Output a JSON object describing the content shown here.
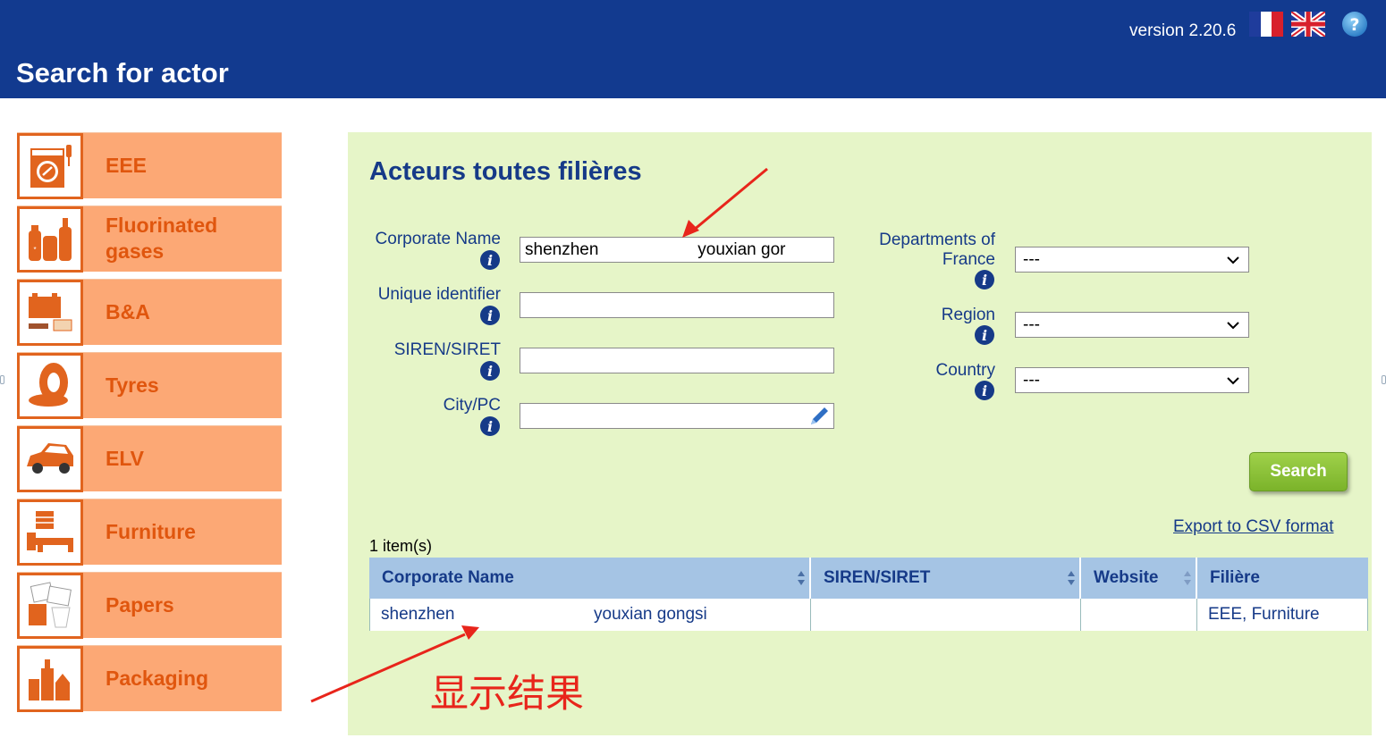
{
  "header": {
    "title": "Search for actor",
    "version": "version 2.20.6",
    "flags": [
      "flag-fr-icon",
      "flag-uk-icon"
    ],
    "help_icon": "help-icon",
    "bg_color": "#123a8f"
  },
  "sidebar": {
    "items": [
      {
        "label": "EEE",
        "icon": "washing-machine-icon"
      },
      {
        "label": "Fluorinated gases",
        "icon": "gas-cylinder-icon"
      },
      {
        "label": "B&A",
        "icon": "battery-icon"
      },
      {
        "label": "Tyres",
        "icon": "tyre-icon"
      },
      {
        "label": "ELV",
        "icon": "car-icon"
      },
      {
        "label": "Furniture",
        "icon": "furniture-icon"
      },
      {
        "label": "Papers",
        "icon": "papers-icon"
      },
      {
        "label": "Packaging",
        "icon": "packaging-icon"
      }
    ],
    "item_color": "#fca875",
    "label_color": "#e0560e"
  },
  "panel": {
    "title": "Acteurs toutes filières",
    "bg_color": "#e6f5c8",
    "fields": {
      "corporate_name": {
        "label": "Corporate Name",
        "value": "shenzhen                     youxian gor"
      },
      "unique_identifier": {
        "label": "Unique identifier",
        "value": ""
      },
      "siren_siret": {
        "label": "SIREN/SIRET",
        "value": ""
      },
      "city_pc": {
        "label": "City/PC",
        "value": ""
      },
      "departments": {
        "label_1": "Departments of",
        "label_2": "France",
        "value": "---"
      },
      "region": {
        "label": "Region",
        "value": "---"
      },
      "country": {
        "label": "Country",
        "value": "---"
      }
    },
    "search_button": "Search",
    "export_link": "Export to CSV format",
    "item_count": "1 item(s)"
  },
  "table": {
    "columns": [
      "Corporate Name",
      "SIREN/SIRET",
      "Website",
      "Filière"
    ],
    "rows": [
      {
        "corporate_name_a": "shenzhen",
        "corporate_name_b": "youxian gongsi",
        "siren_siret": "",
        "website": "",
        "filiere": "EEE, Furniture"
      }
    ],
    "header_color": "#a5c4e4"
  },
  "annotation": {
    "text": "显示结果",
    "color": "#e8251b"
  }
}
